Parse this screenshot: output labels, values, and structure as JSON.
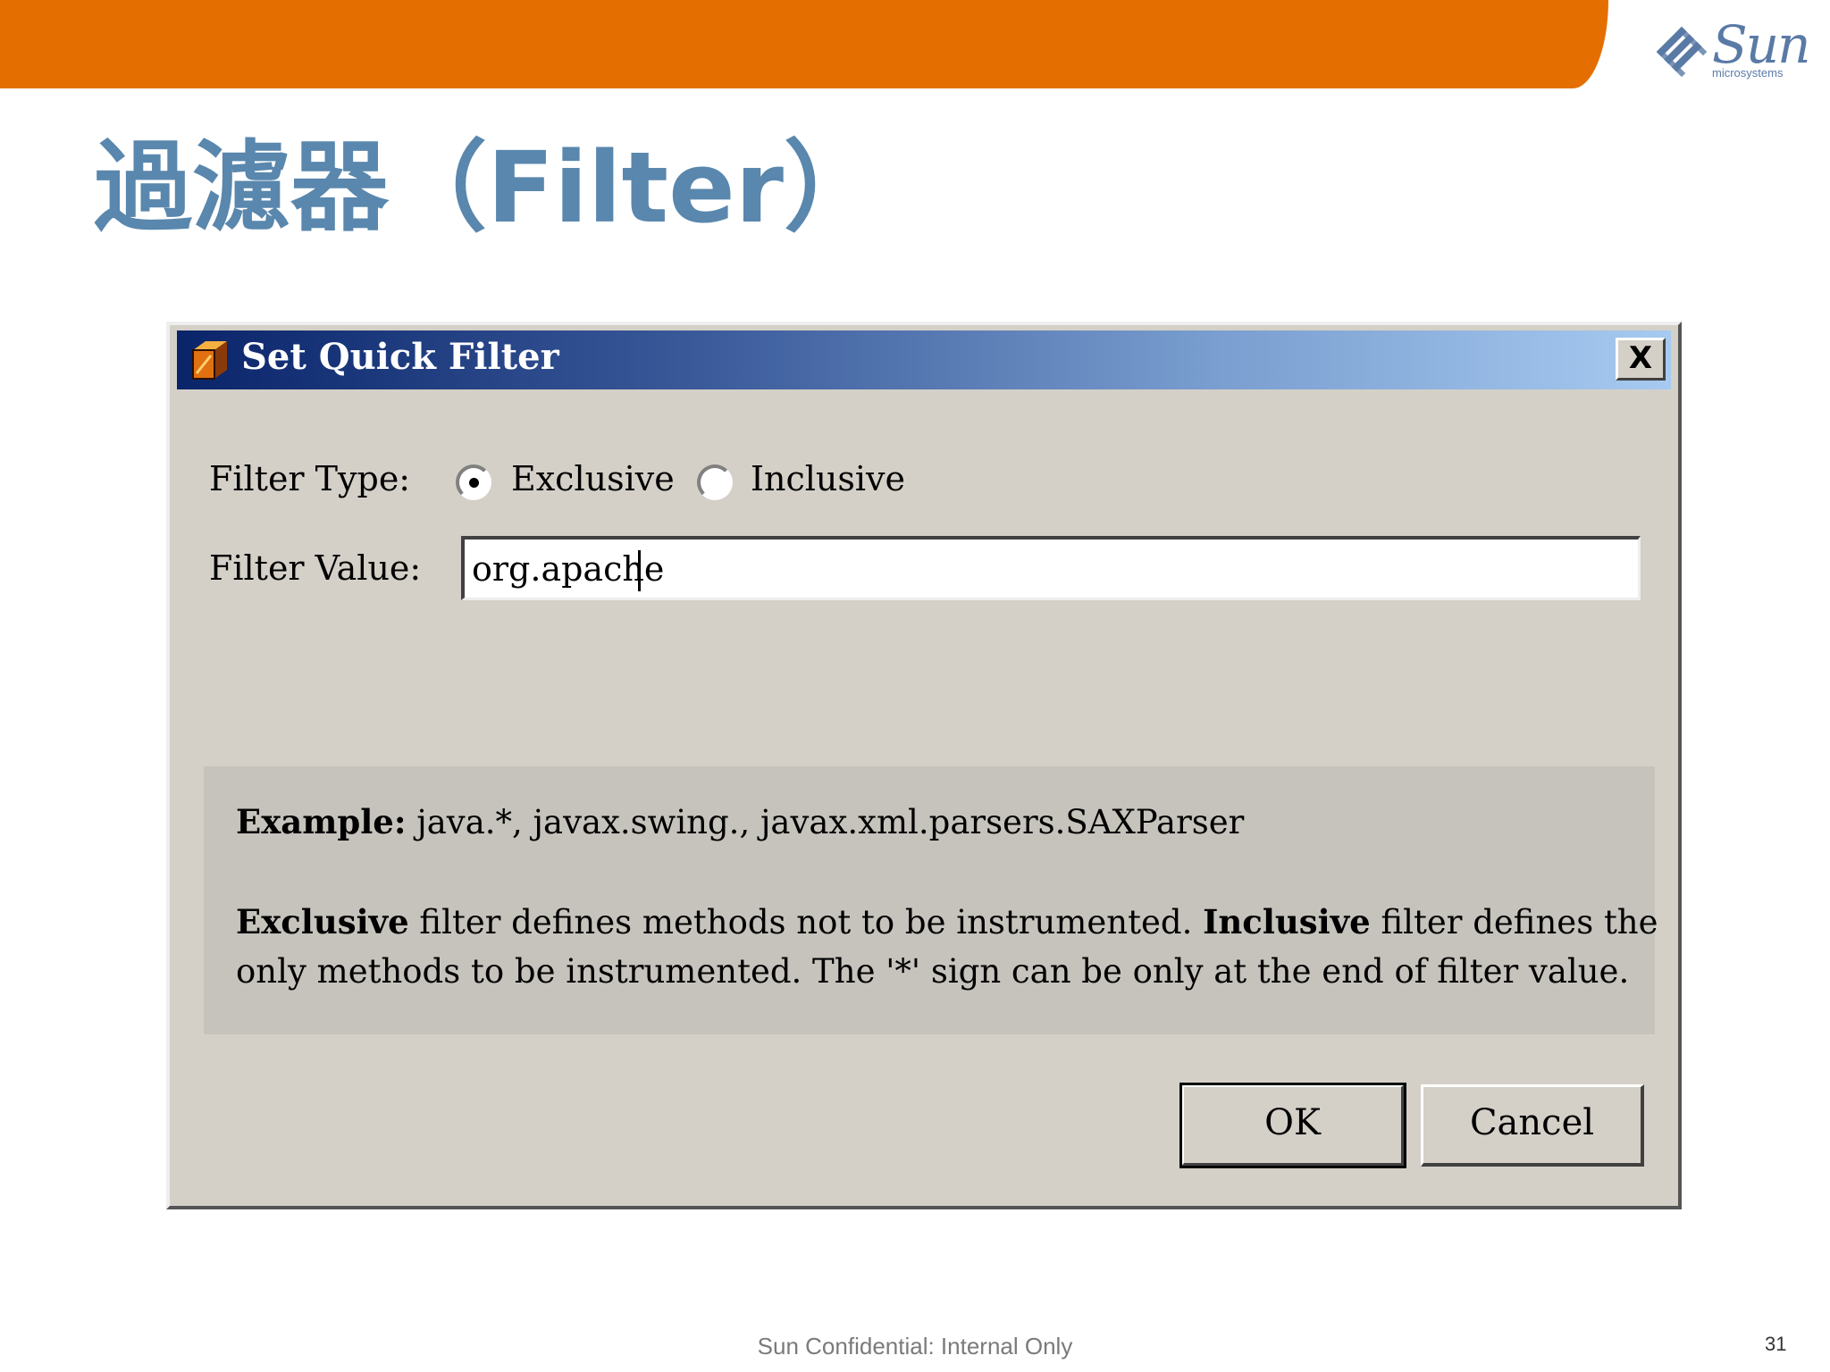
{
  "slide": {
    "title": "過濾器（Filter）",
    "footer": "Sun Confidential: Internal Only",
    "page_number": "31",
    "logo_word": "Sun",
    "logo_sub": "microsystems"
  },
  "dialog": {
    "title": "Set Quick Filter",
    "close_label": "X",
    "filter_type_label": "Filter Type:",
    "radio_options": [
      {
        "label": "Exclusive",
        "selected": true
      },
      {
        "label": "Inclusive",
        "selected": false
      }
    ],
    "filter_value_label": "Filter Value:",
    "filter_value": "org.apache",
    "info": {
      "example_label": "Example:",
      "example_text": " java.*, javax.swing., javax.xml.parsers.SAXParser",
      "exclusive_label": "Exclusive",
      "exclusive_text": " filter defines methods not to be instrumented. ",
      "inclusive_label": "Inclusive",
      "inclusive_text": " filter defines the",
      "line3": "only methods to be instrumented. The '*' sign can be only at the end of filter value."
    },
    "buttons": {
      "ok": "OK",
      "cancel": "Cancel"
    }
  },
  "colors": {
    "top_bar": "#e46f00",
    "title_text": "#5987ad",
    "dialog_bg": "#d4d0c8",
    "titlebar_start": "#0a246a",
    "titlebar_end": "#a6caf0"
  }
}
